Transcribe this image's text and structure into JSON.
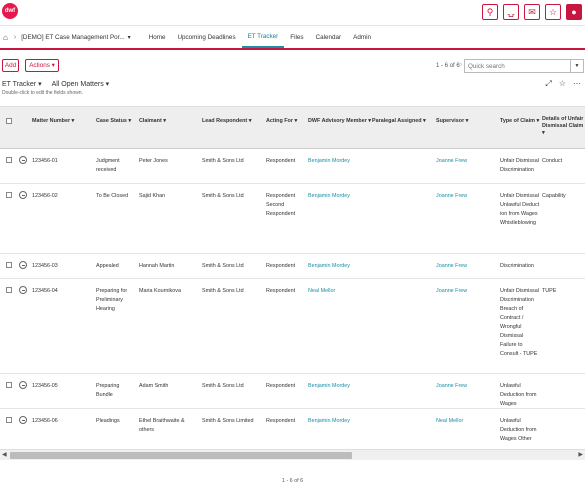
{
  "topbar": {
    "logo_text": "dwf",
    "icons": [
      "search-icon",
      "bell-icon",
      "mail-icon",
      "star-icon",
      "user-icon"
    ]
  },
  "nav": {
    "breadcrumb": "[DEMO] ET Case Management Por...",
    "tabs": [
      "Home",
      "Upcoming Deadlines",
      "ET Tracker",
      "Files",
      "Calendar",
      "Admin"
    ],
    "active_tab": "ET Tracker"
  },
  "toolbar": {
    "add_label": "Add",
    "actions_label": "Actions",
    "count": "1 - 6 of 6",
    "search_placeholder": "Quick search"
  },
  "view": {
    "tracker": "ET Tracker",
    "filter": "All Open Matters",
    "hint": "Double-click to edit the fields shown."
  },
  "columns": [
    "Matter Number",
    "Case Status",
    "Claimant",
    "Lead Respondent",
    "Acting For",
    "DWF Advisory Member",
    "Paralegal Assigned",
    "Supervisor",
    "Type of Claim",
    "Details of Unfair Dismissal Claim"
  ],
  "rows": [
    {
      "matter": "123456-01",
      "status": "Judgment received",
      "claimant": "Peter Jones",
      "respondent": "Smith & Sons Ltd",
      "acting": "Respondent",
      "advisory": "Benjamin Mordey",
      "paralegal": "",
      "supervisor": "Joanne Frew",
      "claim": "Unfair Dismissal Discrimination",
      "details": "Conduct"
    },
    {
      "matter": "123456-02",
      "status": "To Be Closed",
      "claimant": "Sajid Khan",
      "respondent": "Smith & Sons Ltd",
      "acting": "Respondent Second Respondent",
      "advisory": "Benjamin Mordey",
      "paralegal": "",
      "supervisor": "Joanne Frew",
      "claim": "Unfair Dismissal Unlawful Deduction from Wages Whistleblowing",
      "details": "Capability"
    },
    {
      "matter": "123456-03",
      "status": "Appealed",
      "claimant": "Hannah Martin",
      "respondent": "Smith & Sons Ltd",
      "acting": "Respondent",
      "advisory": "Benjamin Mordey",
      "paralegal": "",
      "supervisor": "Joanne Frew",
      "claim": "Discrimination",
      "details": ""
    },
    {
      "matter": "123456-04",
      "status": "Preparing for Preliminary Hearing",
      "claimant": "Maria Kournikova",
      "respondent": "Smith & Sons Ltd",
      "acting": "Respondent",
      "advisory": "Neal Mellor",
      "paralegal": "",
      "supervisor": "Joanne Frew",
      "claim": "Unfair Dismissal Discrimination Breach of Contract / Wrongful Dismissal Failure to Consult - TUPE",
      "details": "TUPE"
    },
    {
      "matter": "123456-05",
      "status": "Preparing Bundle",
      "claimant": "Adam Smith",
      "respondent": "Smith & Sons Ltd",
      "acting": "Respondent",
      "advisory": "Benjamin Mordey",
      "paralegal": "",
      "supervisor": "Joanne Frew",
      "claim": "Unlawful Deduction from Wages",
      "details": ""
    },
    {
      "matter": "123456-06",
      "status": "Pleadings",
      "claimant": "Ethel Braithwaite & others",
      "respondent": "Smith & Sons Limited",
      "acting": "Respondent",
      "advisory": "Benjamin Mordey",
      "paralegal": "",
      "supervisor": "Neal Mellor",
      "claim": "Unlawful Deduction from Wages Other",
      "details": ""
    }
  ],
  "footer": {
    "count": "1 - 6 of 6"
  }
}
